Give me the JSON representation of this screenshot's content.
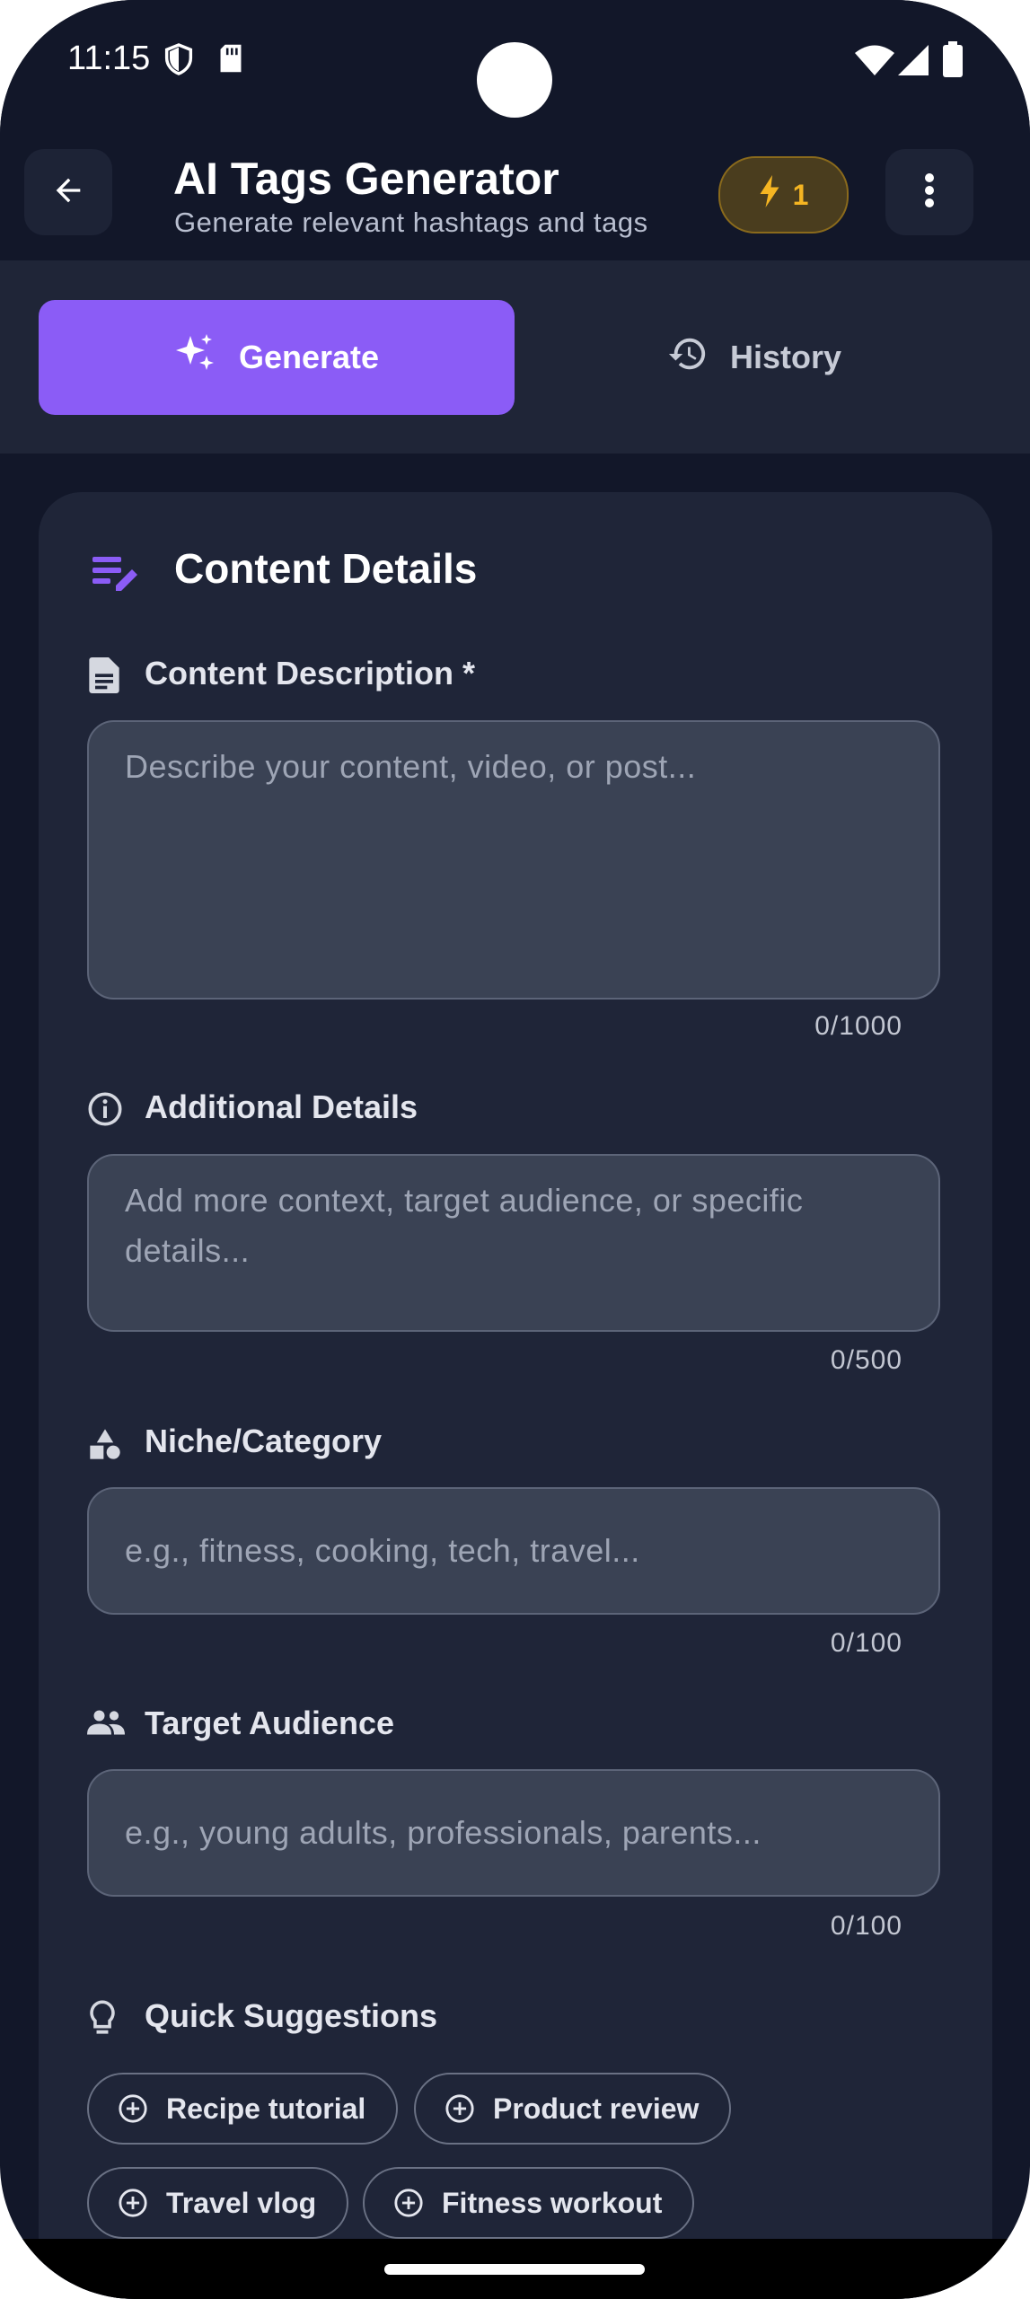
{
  "status_bar": {
    "time": "11:15",
    "icons": [
      "shield-icon",
      "sd-card-icon",
      "wifi-icon",
      "cellular-signal-icon",
      "battery-icon"
    ]
  },
  "app_bar": {
    "title": "AI Tags Generator",
    "subtitle": "Generate relevant hashtags and tags",
    "credits": "1",
    "back_icon": "arrow-back-icon",
    "menu_icon": "more-vert-icon",
    "credit_icon": "bolt-icon"
  },
  "tabs": [
    {
      "label": "Generate",
      "icon": "sparkle-icon",
      "active": true
    },
    {
      "label": "History",
      "icon": "history-icon",
      "active": false
    }
  ],
  "card": {
    "title": "Content Details",
    "icon": "edit-note-icon"
  },
  "fields": {
    "description": {
      "label": "Content Description *",
      "placeholder": "Describe your content, video, or post...",
      "counter": "0/1000",
      "icon": "document-icon"
    },
    "additional": {
      "label": "Additional Details",
      "placeholder": "Add more context, target audience, or specific details...",
      "counter": "0/500",
      "icon": "info-icon"
    },
    "niche": {
      "label": "Niche/Category",
      "placeholder": "e.g., fitness, cooking, tech, travel...",
      "counter": "0/100",
      "icon": "category-icon"
    },
    "audience": {
      "label": "Target Audience",
      "placeholder": "e.g., young adults, professionals, parents...",
      "counter": "0/100",
      "icon": "people-icon"
    }
  },
  "suggestions": {
    "label": "Quick Suggestions",
    "icon": "lightbulb-icon",
    "chips": [
      "Recipe tutorial",
      "Product review",
      "Travel vlog",
      "Fitness workout"
    ]
  },
  "colors": {
    "background": "#121729",
    "card": "#1f2538",
    "accent": "#8b5cf6",
    "credit": "#f5b522"
  }
}
